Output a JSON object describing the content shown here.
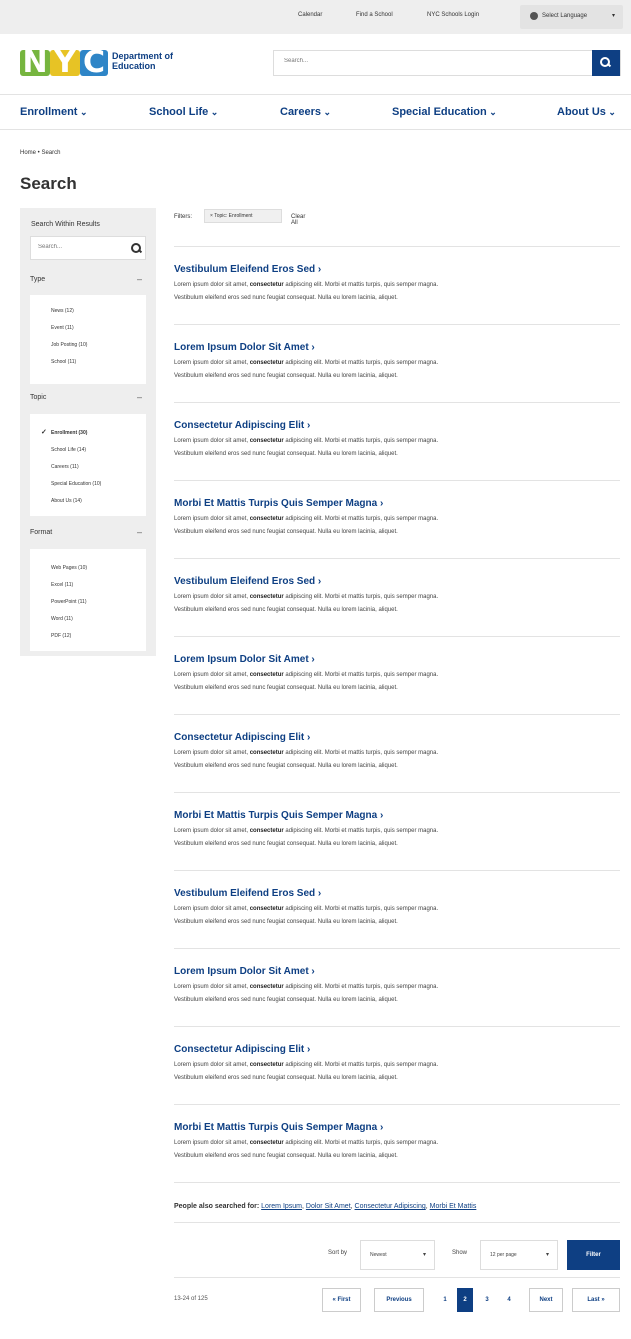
{
  "utility": {
    "calendar": "Calendar",
    "find_school": "Find a School",
    "login": "NYC Schools Login",
    "language": "Select Language"
  },
  "logo": {
    "letters": [
      "N",
      "Y",
      "C"
    ],
    "text": "Department of Education"
  },
  "search": {
    "placeholder": "Search..."
  },
  "nav": [
    "Enrollment",
    "School Life",
    "Careers",
    "Special Education",
    "About Us"
  ],
  "breadcrumb": "Home  •  Search",
  "page_title": "Search",
  "sidebar": {
    "heading": "Search Within Results",
    "placeholder": "Search...",
    "facets": [
      {
        "title": "Type",
        "items": [
          "News (12)",
          "Event (11)",
          "Job Posting (10)",
          "School (11)"
        ]
      },
      {
        "title": "Topic",
        "items": [
          "Enrollment (30)",
          "School Life (14)",
          "Careers (11)",
          "Special Education (10)",
          "About Us (14)"
        ]
      },
      {
        "title": "Format",
        "items": [
          "Web Pages (10)",
          "Excel (11)",
          "PowerPoint (11)",
          "Word (11)",
          "PDF (12)"
        ]
      }
    ]
  },
  "filters": {
    "label": "Filters:",
    "chip": "× Topic: Enrollment",
    "clear": "Clear All"
  },
  "results": [
    {
      "title": "Vestibulum Eleifend Eros Sed ›"
    },
    {
      "title": "Lorem Ipsum Dolor Sit Amet ›"
    },
    {
      "title": "Consectetur Adipiscing Elit ›"
    },
    {
      "title": "Morbi Et Mattis Turpis Quis Semper Magna ›"
    },
    {
      "title": "Vestibulum Eleifend Eros Sed ›"
    },
    {
      "title": "Lorem Ipsum Dolor Sit Amet ›"
    },
    {
      "title": "Consectetur Adipiscing Elit ›"
    },
    {
      "title": "Morbi Et Mattis Turpis Quis Semper Magna ›"
    },
    {
      "title": "Vestibulum Eleifend Eros Sed ›"
    },
    {
      "title": "Lorem Ipsum Dolor Sit Amet ›"
    },
    {
      "title": "Consectetur Adipiscing Elit ›"
    },
    {
      "title": "Morbi Et Mattis Turpis Quis Semper Magna ›"
    }
  ],
  "snippet": {
    "before": "Lorem ipsum dolor sit amet, ",
    "bold": "consectetur",
    "after": " adipiscing elit. Morbi et mattis turpis, quis semper magna.",
    "line2": "Vestibulum eleifend eros sed nunc feugiat consequat. Nulla eu lorem lacinia, aliquet."
  },
  "also": {
    "label": "People also searched for:",
    "links": [
      "Lorem Ipsum",
      "Dolor Sit Amet",
      "Consectetur Adipiscing",
      "Morbi Et Mattis"
    ]
  },
  "sort": {
    "label": "Sort by",
    "value": "Newest",
    "show_label": "Show",
    "show_value": "12 per page",
    "filter_button": "Filter"
  },
  "pagination": {
    "count": "13-24 of 125",
    "first": "« First",
    "previous": "Previous",
    "pages": [
      "1",
      "2",
      "3",
      "4"
    ],
    "current": "2",
    "next": "Next",
    "last": "Last »"
  },
  "colors": {
    "brand": "#0e3f83",
    "logo_n": "#76b53f",
    "logo_y": "#e7c325",
    "logo_c": "#2e85c7",
    "panel": "#eeeeee"
  }
}
